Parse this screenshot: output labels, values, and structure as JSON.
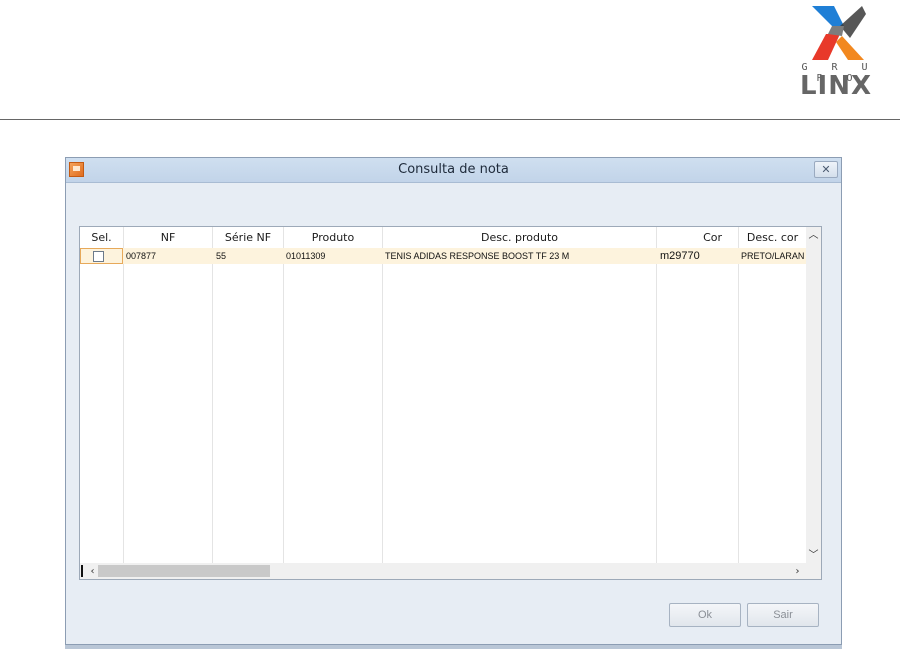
{
  "logo": {
    "top_text": "G R U P O",
    "name": "LINX"
  },
  "dialog": {
    "title": "Consulta de nota",
    "close_symbol": "✕",
    "columns": [
      "Sel.",
      "NF",
      "Série NF",
      "Produto",
      "Desc. produto",
      "Cor",
      "Desc. cor"
    ],
    "rows": [
      {
        "selected": false,
        "nf": "007877",
        "serie_nf": "55",
        "produto": "01011309",
        "desc_produto": "TENIS ADIDAS RESPONSE BOOST TF 23 M",
        "cor": "m29770",
        "desc_cor": "PRETO/LARAN"
      }
    ],
    "buttons": {
      "ok": "Ok",
      "sair": "Sair"
    }
  },
  "icons": {
    "app": "app-window-icon",
    "close": "close-icon",
    "scroll_up": "chevron-up-icon",
    "scroll_down": "chevron-down-icon",
    "scroll_left": "chevron-left-icon",
    "scroll_right": "chevron-right-icon"
  },
  "colors": {
    "selected_row": "#fdf3dd",
    "logo_blue": "#1f7fd6",
    "logo_red": "#e8392a",
    "logo_orange": "#f2881f"
  }
}
